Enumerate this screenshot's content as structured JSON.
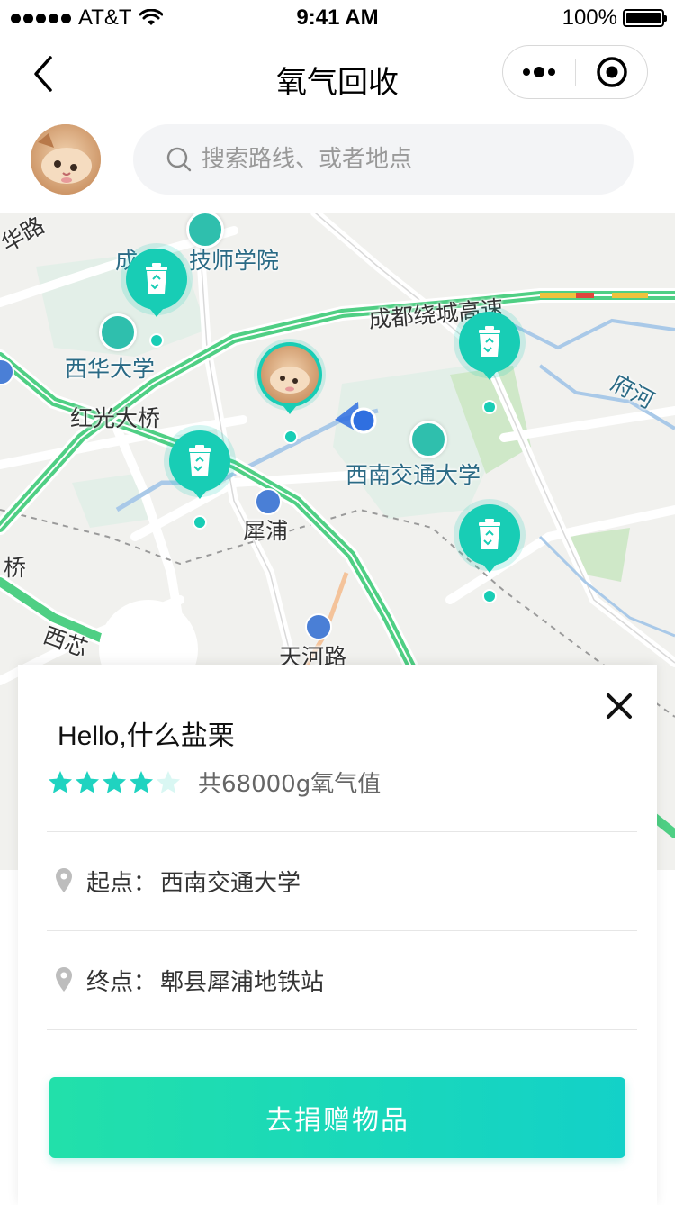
{
  "status_bar": {
    "carrier": "AT&T",
    "time": "9:41 AM",
    "battery": "100%"
  },
  "nav": {
    "title": "氧气回收"
  },
  "search": {
    "placeholder": "搜索路线、或者地点"
  },
  "map": {
    "labels": {
      "xihua_univ": "西华大学",
      "hongguang_bridge": "红光大桥",
      "swjtu": "西南交通大学",
      "xipu": "犀浦",
      "tianhe_road": "天河路",
      "ring_expressway": "成都绕城高速",
      "fuhe": "府河",
      "tech_college_a": "成",
      "tech_college_b": "技师学院",
      "bridge_left": "桥",
      "xi_fragment": "西芯",
      "left_top_fragment": "华路"
    }
  },
  "card": {
    "name": "Hello,什么盐栗",
    "rating": 4,
    "rating_max": 5,
    "oxygen_text": "共68000g氧气值",
    "start_label": "起点：",
    "start_value": "西南交通大学",
    "end_label": "终点：",
    "end_value": "郫县犀浦地铁站",
    "button_label": "去捐赠物品"
  },
  "colors": {
    "accent": "#18cdb5",
    "button_start": "#22e0aa",
    "button_end": "#13d1c8",
    "star_filled": "#1fd3c0",
    "star_empty": "#d9f7f3"
  }
}
